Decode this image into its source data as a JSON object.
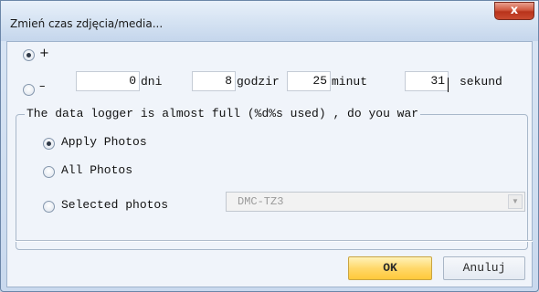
{
  "window": {
    "title": "Zmień czas zdjęcia/media...",
    "close_label": "x"
  },
  "offset": {
    "plus_label": "+",
    "minus_label": "–",
    "selected_sign": "+",
    "days_value": "0",
    "days_label": "dni",
    "hours_value": "8",
    "hours_label": "godzir",
    "minutes_value": "25",
    "minutes_label": "minut",
    "seconds_value": "31",
    "seconds_label": "sekund"
  },
  "group": {
    "legend": "The data logger is almost full (%d%s used) , do you war",
    "options": [
      {
        "label": "Apply Photos",
        "checked": true
      },
      {
        "label": "All Photos",
        "checked": false
      },
      {
        "label": "Selected photos",
        "checked": false
      }
    ],
    "camera_select_value": "DMC-TZ3"
  },
  "buttons": {
    "ok_label": "OK",
    "cancel_label": "Anuluj"
  },
  "colors": {
    "ok_button": "#ffd86a",
    "close_button": "#c94a30"
  },
  "icons": {
    "close": "close-icon",
    "dropdown": "chevron-down-icon"
  }
}
